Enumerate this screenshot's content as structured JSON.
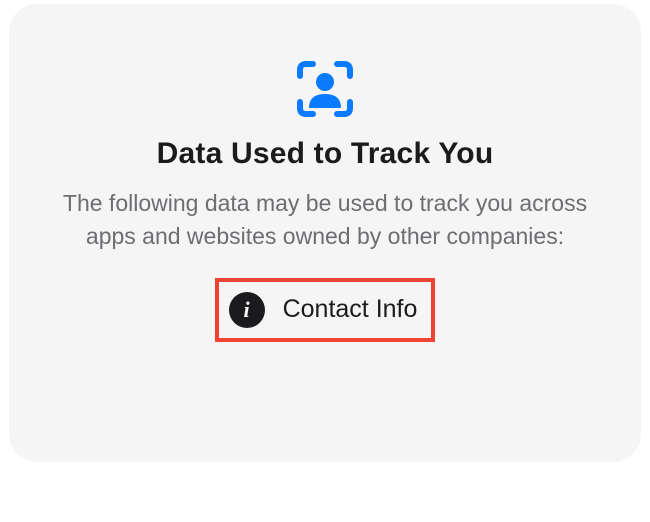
{
  "privacy": {
    "heading": "Data Used to Track You",
    "subtitle": "The following data may be used to track you across apps and websites owned by other companies:",
    "items": [
      {
        "icon_glyph": "i",
        "label": "Contact Info"
      }
    ]
  },
  "colors": {
    "accent": "#0a7aff",
    "highlight_border": "#ef4333"
  }
}
